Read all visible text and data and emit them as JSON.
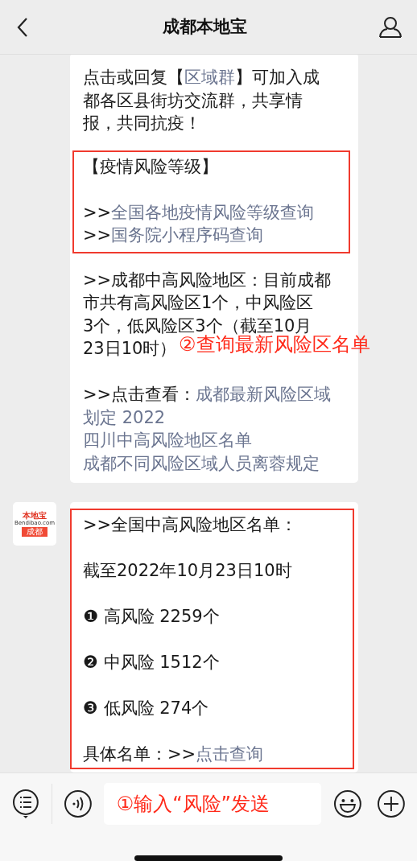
{
  "header": {
    "title": "成都本地宝"
  },
  "messages": [
    {
      "blocks": [
        {
          "boxed": false,
          "paragraphs": [
            {
              "lines": [
                {
                  "parts": [
                    {
                      "text": "点击或回复【",
                      "link": false
                    },
                    {
                      "text": "区域群",
                      "link": true
                    },
                    {
                      "text": "】可加入成",
                      "link": false
                    }
                  ]
                },
                {
                  "parts": [
                    {
                      "text": "都各区县街坊交流群，共享情",
                      "link": false
                    }
                  ]
                },
                {
                  "parts": [
                    {
                      "text": "报，共同抗疫！",
                      "link": false
                    }
                  ]
                }
              ]
            }
          ]
        },
        {
          "boxed": true,
          "paragraphs": [
            {
              "lines": [
                {
                  "parts": [
                    {
                      "text": "【疫情风险等级】",
                      "link": false
                    }
                  ]
                }
              ]
            },
            {
              "lines": [
                {
                  "parts": [
                    {
                      "text": ">>",
                      "link": false
                    },
                    {
                      "text": "全国各地疫情风险等级查询",
                      "link": true
                    }
                  ]
                },
                {
                  "parts": [
                    {
                      "text": ">>",
                      "link": false
                    },
                    {
                      "text": "国务院小程序码查询",
                      "link": true
                    }
                  ]
                }
              ]
            }
          ]
        },
        {
          "boxed": false,
          "paragraphs": [
            {
              "lines": [
                {
                  "parts": [
                    {
                      "text": ">>成都中高风险地区：目前成都",
                      "link": false
                    }
                  ]
                },
                {
                  "parts": [
                    {
                      "text": "市共有高风险区1个，中风险区",
                      "link": false
                    }
                  ]
                },
                {
                  "parts": [
                    {
                      "text": "3个，低风险区3个（截至10月",
                      "link": false
                    }
                  ]
                },
                {
                  "parts": [
                    {
                      "text": "23日10时）",
                      "link": false
                    }
                  ]
                }
              ]
            },
            {
              "lines": [
                {
                  "parts": [
                    {
                      "text": ">>点击查看：",
                      "link": false
                    },
                    {
                      "text": "成都最新风险区域",
                      "link": true
                    }
                  ]
                },
                {
                  "parts": [
                    {
                      "text": "划定 2022",
                      "link": true
                    }
                  ]
                },
                {
                  "parts": [
                    {
                      "text": "四川中高风险地区名单",
                      "link": true
                    }
                  ]
                },
                {
                  "parts": [
                    {
                      "text": "成都不同风险区域人员离蓉规定",
                      "link": true
                    }
                  ]
                }
              ]
            }
          ]
        }
      ],
      "annotation": "②查询最新风险区名单"
    },
    {
      "avatar": {
        "name": "本地宝",
        "site": "Bendibao.com",
        "city": "成都"
      },
      "blocks": [
        {
          "boxed": true,
          "paragraphs": [
            {
              "lines": [
                {
                  "parts": [
                    {
                      "text": ">>全国中高风险地区名单：",
                      "link": false
                    }
                  ]
                }
              ]
            },
            {
              "lines": [
                {
                  "parts": [
                    {
                      "text": "截至2022年10月23日10时",
                      "link": false
                    }
                  ]
                }
              ]
            },
            {
              "lines": [
                {
                  "parts": [
                    {
                      "text": "❶ 高风险 2259个",
                      "link": false
                    }
                  ]
                }
              ]
            },
            {
              "lines": [
                {
                  "parts": [
                    {
                      "text": "❷ 中风险 1512个",
                      "link": false
                    }
                  ]
                }
              ]
            },
            {
              "lines": [
                {
                  "parts": [
                    {
                      "text": "❸ 低风险 274个",
                      "link": false
                    }
                  ]
                }
              ]
            },
            {
              "lines": [
                {
                  "parts": [
                    {
                      "text": "具体名单：>>",
                      "link": false
                    },
                    {
                      "text": "点击查询",
                      "link": true
                    }
                  ]
                }
              ]
            }
          ]
        }
      ]
    }
  ],
  "input": {
    "annotation": "①输入“风险”发送"
  }
}
